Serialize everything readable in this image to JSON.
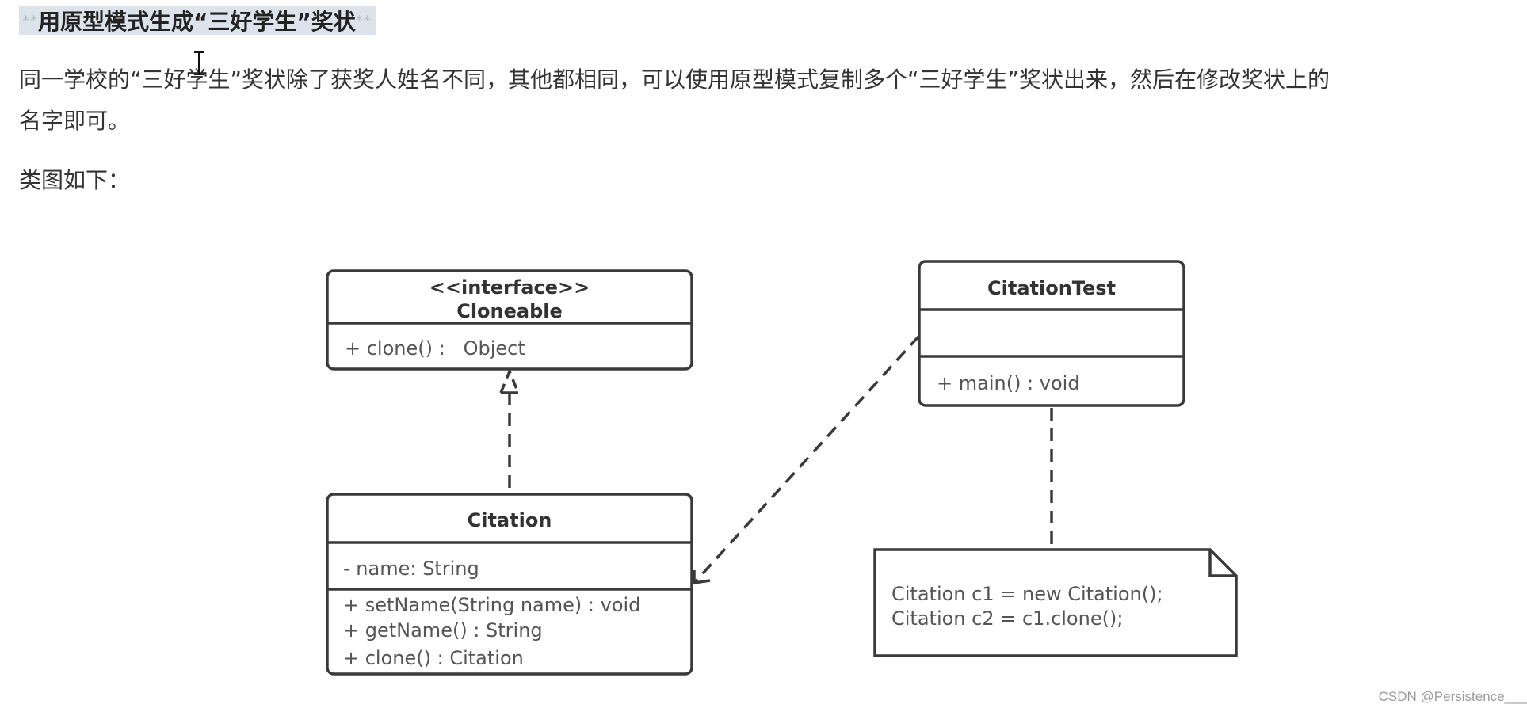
{
  "heading": {
    "prefix_stars": "**",
    "title": "用原型模式生成“三好学生”奖状",
    "suffix_stars": "**"
  },
  "paragraphs": {
    "line1": "同一学校的“三好学生”奖状除了获奖人姓名不同，其他都相同，可以使用原型模式复制多个“三好学生”奖状出来，然后在修改奖状上的",
    "line2": "名字即可。",
    "line3": "类图如下："
  },
  "diagram": {
    "cloneable": {
      "stereotype": "<<interface>>",
      "name": "Cloneable",
      "methods": [
        "+ clone() :   Object"
      ]
    },
    "citation": {
      "name": "Citation",
      "attributes": [
        "- name: String"
      ],
      "methods": [
        "+ setName(String name) : void",
        "+ getName() : String",
        "+ clone() : Citation"
      ]
    },
    "citation_test": {
      "name": "CitationTest",
      "attributes": [],
      "methods": [
        "+ main() : void"
      ]
    },
    "note": {
      "lines": [
        "Citation c1 = new Citation();",
        "Citation c2 = c1.clone();"
      ]
    },
    "line_color": "#3a3a3a"
  },
  "watermark": "CSDN @Persistence___"
}
